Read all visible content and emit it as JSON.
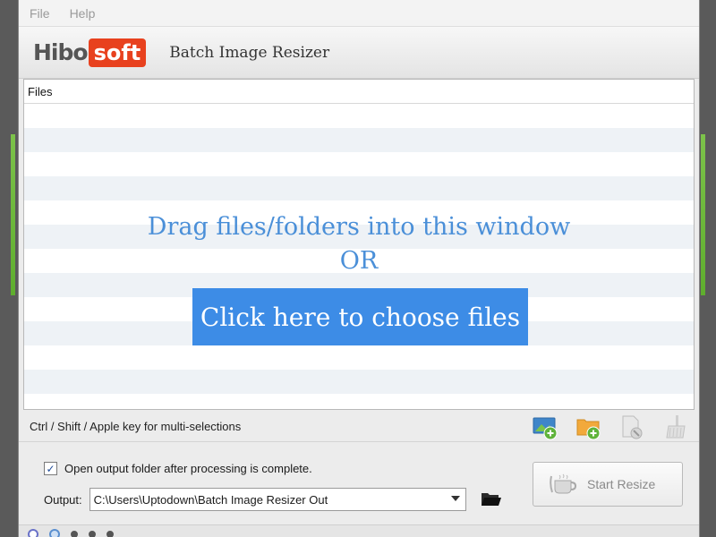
{
  "menu": {
    "file": "File",
    "help": "Help"
  },
  "header": {
    "logo_hibo": "Hibo",
    "logo_soft": "soft",
    "app_title": "Batch Image Resizer"
  },
  "panel": {
    "column_header": "Files",
    "drop_line1": "Drag files/folders into this window",
    "drop_line2": "OR",
    "choose_button": "Click here to choose files"
  },
  "hint": "Ctrl / Shift / Apple key for multi-selections",
  "tools": [
    {
      "icon": "add-image-icon"
    },
    {
      "icon": "add-folder-icon"
    },
    {
      "icon": "remove-file-icon"
    },
    {
      "icon": "clear-list-icon"
    }
  ],
  "options": {
    "open_folder_checked": true,
    "check_mark": "✓",
    "open_folder_label": "Open output folder after processing is complete.",
    "output_label": "Output:",
    "output_path": "C:\\Users\\Uptodown\\Batch Image Resizer Out"
  },
  "start_button": "Start Resize",
  "colors": {
    "accent_blue": "#3d8ce6",
    "drop_text_blue": "#4a8fd8",
    "logo_red": "#e8411e",
    "side_glow": "#7cc24a"
  }
}
